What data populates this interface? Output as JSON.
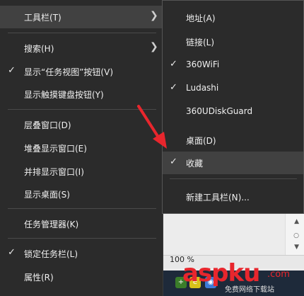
{
  "main_menu": {
    "items": [
      {
        "label": "工具栏(T)",
        "checked": false,
        "submenu": true,
        "highlighted": true
      },
      {
        "label": "搜索(H)",
        "checked": false,
        "submenu": true
      },
      {
        "label": "显示“任务视图”按钮(V)",
        "checked": true
      },
      {
        "label": "显示触摸键盘按钮(Y)",
        "checked": false
      },
      {
        "label": "层叠窗口(D)",
        "checked": false
      },
      {
        "label": "堆叠显示窗口(E)",
        "checked": false
      },
      {
        "label": "并排显示窗口(I)",
        "checked": false
      },
      {
        "label": "显示桌面(S)",
        "checked": false
      },
      {
        "label": "任务管理器(K)",
        "checked": false
      },
      {
        "label": "锁定任务栏(L)",
        "checked": true
      },
      {
        "label": "属性(R)",
        "checked": false
      }
    ]
  },
  "toolbar_submenu": {
    "items": [
      {
        "label": "地址(A)",
        "checked": false
      },
      {
        "label": "链接(L)",
        "checked": false
      },
      {
        "label": "360WiFi",
        "checked": true
      },
      {
        "label": "Ludashi",
        "checked": true
      },
      {
        "label": "360UDiskGuard",
        "checked": false
      },
      {
        "label": "桌面(D)",
        "checked": false
      },
      {
        "label": "收藏",
        "checked": true,
        "highlighted": true
      },
      {
        "label": "新建工具栏(N)...",
        "checked": false
      }
    ]
  },
  "background": {
    "zoom_label": "100 %",
    "tray_label": "免费网络下载站"
  },
  "watermark": {
    "brand": "aspku",
    "suffix": ".com"
  },
  "icons": {
    "check": "checkmark-icon",
    "submenu_arrow": "chevron-right-icon",
    "annotation": "red-arrow-icon"
  },
  "colors": {
    "menu_bg": "#2b2b2b",
    "highlight_bg": "#414141",
    "annotation_red": "#e8262d"
  }
}
